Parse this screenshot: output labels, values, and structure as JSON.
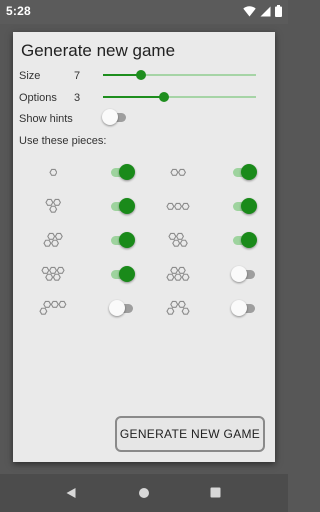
{
  "status": {
    "time": "5:28"
  },
  "dialog": {
    "title": "Generate new game",
    "size": {
      "label": "Size",
      "value": "7",
      "fraction": 0.25
    },
    "options": {
      "label": "Options",
      "value": "3",
      "fraction": 0.4
    },
    "show_hints": {
      "label": "Show hints",
      "on": false
    },
    "pieces_label": "Use these pieces:",
    "pieces": [
      {
        "name": "piece-1-hex",
        "on": true
      },
      {
        "name": "piece-2-hex",
        "on": true
      },
      {
        "name": "piece-3-hex-triangle",
        "on": true
      },
      {
        "name": "piece-3-hex-line",
        "on": true
      },
      {
        "name": "piece-4-hex-a",
        "on": true
      },
      {
        "name": "piece-4-hex-b",
        "on": true
      },
      {
        "name": "piece-5-hex-a",
        "on": true
      },
      {
        "name": "piece-6-hex-pyramid",
        "on": false
      },
      {
        "name": "piece-4-hex-line",
        "on": false
      },
      {
        "name": "piece-5-hex-b",
        "on": false
      }
    ],
    "generate_button": "GENERATE NEW GAME"
  },
  "colors": {
    "accent": "#1e8e1e",
    "accent_light": "#9ed39e",
    "hex_stroke": "#8c8c8c"
  },
  "navbar": {
    "icons": [
      "back-icon",
      "home-icon",
      "recents-icon"
    ]
  }
}
